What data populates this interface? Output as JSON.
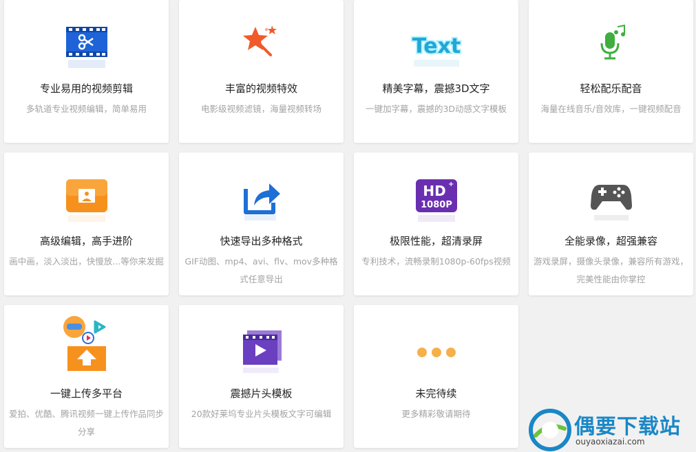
{
  "features": [
    {
      "icon": "video-edit-icon",
      "title": "专业易用的视频剪辑",
      "desc": "多轨道专业视频编辑，简单易用"
    },
    {
      "icon": "magic-wand-icon",
      "title": "丰富的视频特效",
      "desc": "电影级视频滤镜，海量视频转场"
    },
    {
      "icon": "text-3d-icon",
      "icon_text": "Text",
      "title": "精美字幕，震撼3D文字",
      "desc": "一键加字幕，震撼的3D动感文字模板"
    },
    {
      "icon": "microphone-music-icon",
      "title": "轻松配乐配音",
      "desc": "海量在线音乐/音效库，一键视频配音"
    },
    {
      "icon": "picture-in-picture-icon",
      "title": "高级编辑，高手进阶",
      "desc": "画中画，淡入淡出，快慢放...等你来发掘"
    },
    {
      "icon": "export-share-icon",
      "title": "快速导出多种格式",
      "desc": "GIF动图、mp4、avi、flv、mov多种格式任意导出"
    },
    {
      "icon": "hd-1080p-icon",
      "icon_text": "HD",
      "icon_sub": "1080P",
      "title": "极限性能，超清录屏",
      "desc": "专利技术，流畅录制1080p-60fps视频"
    },
    {
      "icon": "gamepad-icon",
      "title": "全能录像，超强兼容",
      "desc": "游戏录屏，摄像头录像，兼容所有游戏，完美性能由你掌控"
    },
    {
      "icon": "multi-platform-upload-icon",
      "title": "一键上传多平台",
      "desc": "爱拍、优酷、腾讯视频一键上传作品同步分享"
    },
    {
      "icon": "video-template-icon",
      "title": "震撼片头模板",
      "desc": "20款好莱坞专业片头模板文字可编辑"
    },
    {
      "icon": "more-dots-icon",
      "title": "未完待续",
      "desc": "更多精彩敬请期待"
    }
  ],
  "watermark": {
    "title": "偶要下载站",
    "url": "ouyaoxiazai.com"
  },
  "colors": {
    "background": "#f1f1f1",
    "card": "#ffffff",
    "title": "#222222",
    "desc": "#a3a3a3",
    "brand": "#1a87c6"
  }
}
